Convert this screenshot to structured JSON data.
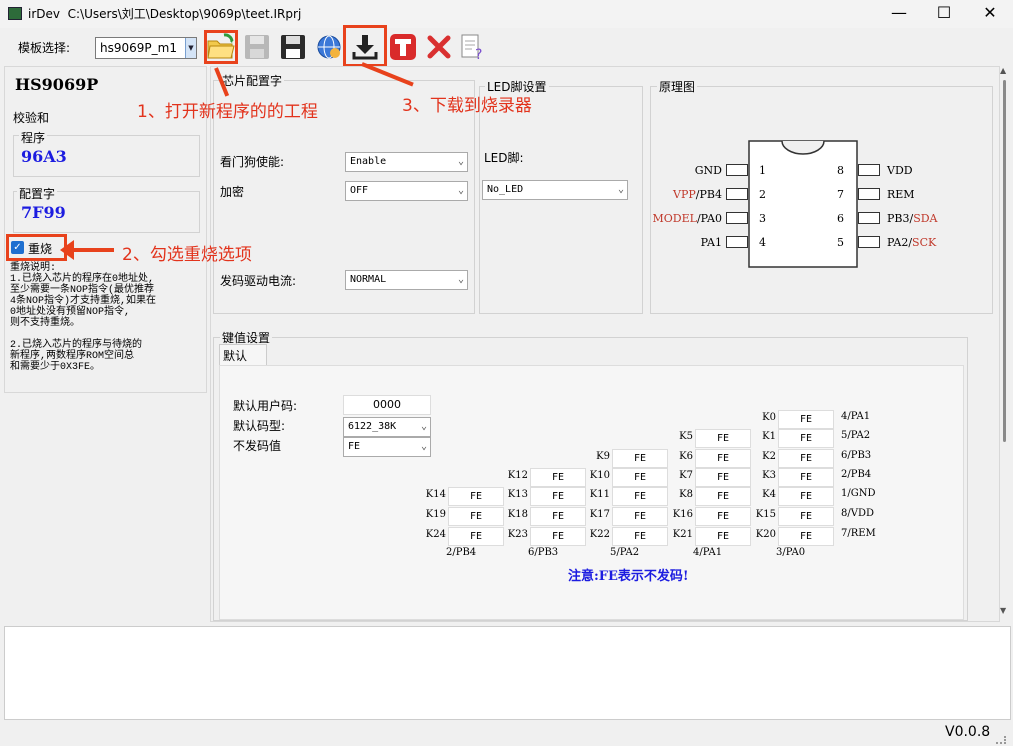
{
  "window": {
    "app": "irDev",
    "path": "C:\\Users\\刘工\\Desktop\\9069p\\teet.IRprj",
    "minimize": "—",
    "maximize": "☐",
    "close": "✕"
  },
  "toolbar": {
    "template_label": "模板选择:",
    "template_value": "hs9069P_m1"
  },
  "annotations": {
    "step1": "1、打开新程序的的工程",
    "step2": "2、勾选重烧选项",
    "step3": "3、下载到烧录器"
  },
  "left": {
    "chip_name": "HS9069P",
    "checksum_label": "校验和",
    "program_label": "程序",
    "program_value": "96A3",
    "config_label": "配置字",
    "config_value": "7F99",
    "reburn_label": "重烧",
    "reburn_checked": true,
    "notes": [
      "重烧说明:",
      "1.已烧入芯片的程序在0地址处,",
      "至少需要一条NOP指令(最优推荐",
      "4条NOP指令)才支持重烧,如果在",
      "0地址处没有预留NOP指令,",
      "则不支持重烧。",
      "",
      "2.已烧入芯片的程序与待烧的",
      "新程序,两数程序ROM空间总",
      "和需要少于0X3FE。"
    ]
  },
  "chip_config": {
    "title": "芯片配置字",
    "watchdog_label": "看门狗使能:",
    "watchdog_value": "Enable",
    "encrypt_label": "加密",
    "encrypt_value": "OFF",
    "drive_label": "发码驱动电流:",
    "drive_value": "NORMAL"
  },
  "led": {
    "title": "LED脚设置",
    "pin_label": "LED脚:",
    "pin_value": "No_LED"
  },
  "schematic": {
    "title": "原理图",
    "left_pins": [
      {
        "num": "1",
        "name": "GND",
        "prefix": ""
      },
      {
        "num": "2",
        "name": "/PB4",
        "prefix": "VPP"
      },
      {
        "num": "3",
        "name": "/PA0",
        "prefix": "MODEL"
      },
      {
        "num": "4",
        "name": "PA1",
        "prefix": ""
      }
    ],
    "right_pins": [
      {
        "num": "8",
        "name": "VDD",
        "suffix": ""
      },
      {
        "num": "7",
        "name": "REM",
        "suffix": ""
      },
      {
        "num": "6",
        "name": "PB3/",
        "suffix": "SDA"
      },
      {
        "num": "5",
        "name": "PA2/",
        "suffix": "SCK"
      }
    ],
    "accent_color": "#c0392b"
  },
  "keys": {
    "title": "键值设置",
    "tab": "默认",
    "user_code_label": "默认用户码:",
    "user_code_value": "0000",
    "code_type_label": "默认码型:",
    "code_type_value": "6122_38K",
    "nocode_label": "不发码值",
    "nocode_value": "FE",
    "cols": [
      {
        "bottom": "2/PB4",
        "keys": [
          [
            "K14",
            "FE"
          ],
          [
            "K19",
            "FE"
          ],
          [
            "K24",
            "FE"
          ]
        ]
      },
      {
        "bottom": "6/PB3",
        "keys": [
          [
            "K12",
            "FE"
          ],
          [
            "K13",
            "FE"
          ],
          [
            "K18",
            "FE"
          ],
          [
            "K23",
            "FE"
          ]
        ]
      },
      {
        "bottom": "5/PA2",
        "keys": [
          [
            "K9",
            "FE"
          ],
          [
            "K10",
            "FE"
          ],
          [
            "K11",
            "FE"
          ],
          [
            "K17",
            "FE"
          ],
          [
            "K22",
            "FE"
          ]
        ]
      },
      {
        "bottom": "4/PA1",
        "keys": [
          [
            "K5",
            "FE"
          ],
          [
            "K6",
            "FE"
          ],
          [
            "K7",
            "FE"
          ],
          [
            "K8",
            "FE"
          ],
          [
            "K16",
            "FE"
          ],
          [
            "K21",
            "FE"
          ]
        ]
      },
      {
        "bottom": "3/PA0",
        "keys": [
          [
            "K0",
            "FE"
          ],
          [
            "K1",
            "FE"
          ],
          [
            "K2",
            "FE"
          ],
          [
            "K3",
            "FE"
          ],
          [
            "K4",
            "FE"
          ],
          [
            "K15",
            "FE"
          ],
          [
            "K20",
            "FE"
          ]
        ]
      }
    ],
    "right_pins": [
      "4/PA1",
      "5/PA2",
      "6/PB3",
      "2/PB4",
      "1/GND",
      "8/VDD",
      "7/REM"
    ],
    "note": "注意:FE表示不发码!"
  },
  "status": {
    "version": "V0.0.8"
  }
}
